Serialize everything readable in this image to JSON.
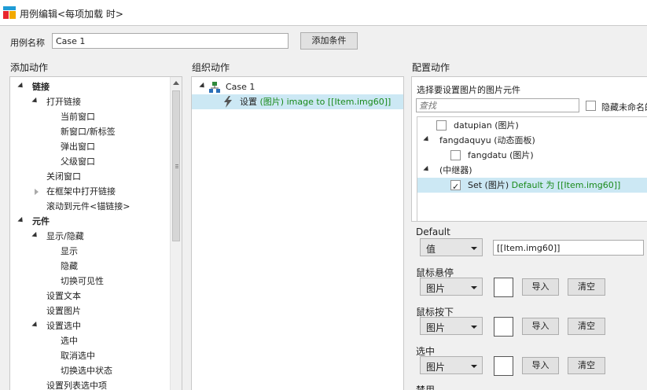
{
  "window": {
    "title": "用例编辑<每项加载 时>"
  },
  "case_name": {
    "label": "用例名称",
    "value": "Case 1",
    "add_condition": "添加条件"
  },
  "add_action": {
    "header": "添加动作",
    "items": [
      "链接",
      "打开链接",
      "当前窗口",
      "新窗口/新标签",
      "弹出窗口",
      "父级窗口",
      "关闭窗口",
      "在框架中打开链接",
      "滚动到元件<锚链接>",
      "元件",
      "显示/隐藏",
      "显示",
      "隐藏",
      "切换可见性",
      "设置文本",
      "设置图片",
      "设置选中",
      "选中",
      "取消选中",
      "切换选中状态",
      "设置列表选中项"
    ]
  },
  "organize_action": {
    "header": "组织动作",
    "case_label": "Case 1",
    "action": {
      "prefix": "设置 ",
      "target": "(图片) image to [[Item.img60]]"
    }
  },
  "configure_action": {
    "header": "配置动作",
    "select_label": "选择要设置图片的图片元件",
    "search_placeholder": "查找",
    "hide_unnamed": "隐藏未命名的",
    "widgets": [
      {
        "name": "datupian (图片)"
      },
      {
        "name": "fangdaquyu (动态面板)"
      },
      {
        "name": "fangdatu (图片)"
      },
      {
        "name": "(中继器)"
      },
      {
        "name": "Set (图片) ",
        "detail": "Default 为 [[Item.img60]]"
      }
    ],
    "default": {
      "label": "Default",
      "type": "值",
      "value": "[[Item.img60]]"
    },
    "states": [
      {
        "label": "鼠标悬停",
        "type": "图片",
        "import": "导入",
        "clear": "清空"
      },
      {
        "label": "鼠标按下",
        "type": "图片",
        "import": "导入",
        "clear": "清空"
      },
      {
        "label": "选中",
        "type": "图片",
        "import": "导入",
        "clear": "清空"
      }
    ],
    "partial_label": "禁用"
  }
}
